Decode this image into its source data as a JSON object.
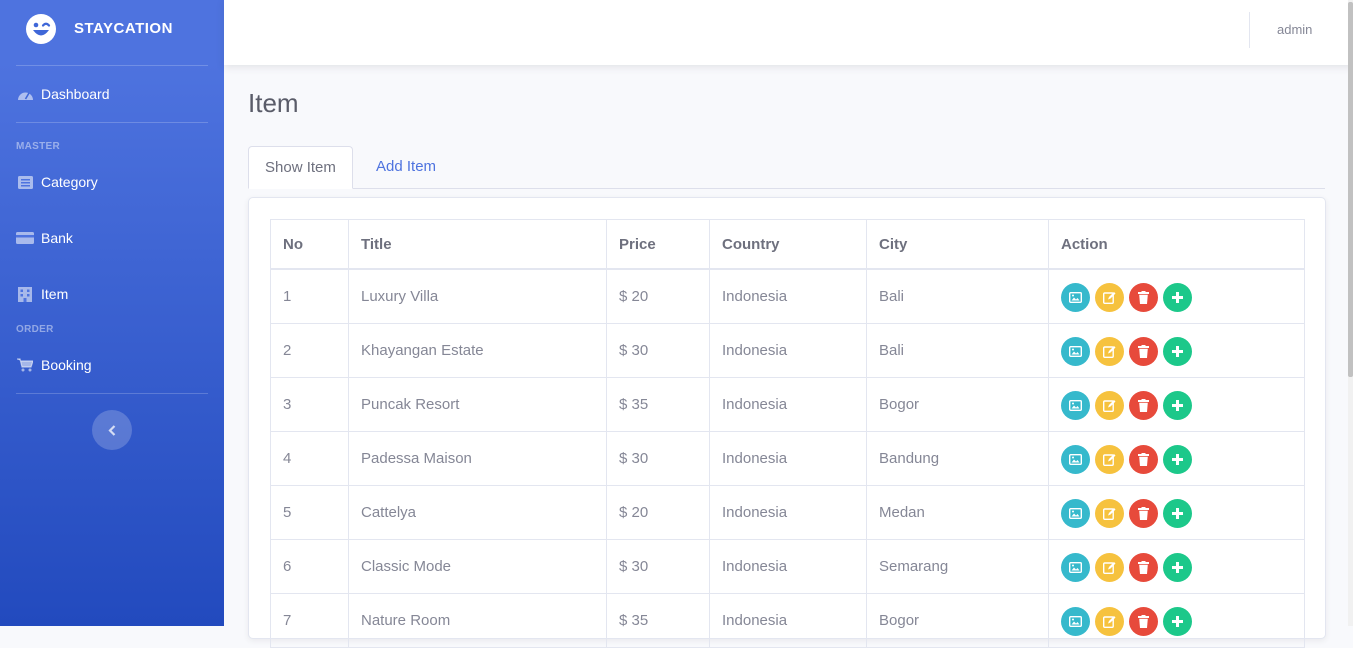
{
  "sidebar": {
    "brand": "STAYCATION",
    "dashboard": "Dashboard",
    "heading_master": "MASTER",
    "category": "Category",
    "bank": "Bank",
    "item": "Item",
    "heading_order": "ORDER",
    "booking": "Booking"
  },
  "topbar": {
    "user": "admin"
  },
  "page": {
    "title": "Item",
    "tabs": [
      "Show Item",
      "Add Item"
    ]
  },
  "table": {
    "headers": [
      "No",
      "Title",
      "Price",
      "Country",
      "City",
      "Action"
    ],
    "rows": [
      [
        "1",
        "Luxury Villa",
        "$ 20",
        "Indonesia",
        "Bali"
      ],
      [
        "2",
        "Khayangan Estate",
        "$ 30",
        "Indonesia",
        "Bali"
      ],
      [
        "3",
        "Puncak Resort",
        "$ 35",
        "Indonesia",
        "Bogor"
      ],
      [
        "4",
        "Padessa Maison",
        "$ 30",
        "Indonesia",
        "Bandung"
      ],
      [
        "5",
        "Cattelya",
        "$ 20",
        "Indonesia",
        "Medan"
      ],
      [
        "6",
        "Classic Mode",
        "$ 30",
        "Indonesia",
        "Semarang"
      ],
      [
        "7",
        "Nature Room",
        "$ 35",
        "Indonesia",
        "Bogor"
      ]
    ],
    "actions": [
      "image-icon",
      "edit-icon",
      "trash-icon",
      "plus-icon"
    ]
  },
  "colors": {
    "primary": "#4e73df",
    "info": "#36b9cc",
    "warning": "#f6c23e",
    "danger": "#e74a3b",
    "success": "#1cc88a"
  }
}
